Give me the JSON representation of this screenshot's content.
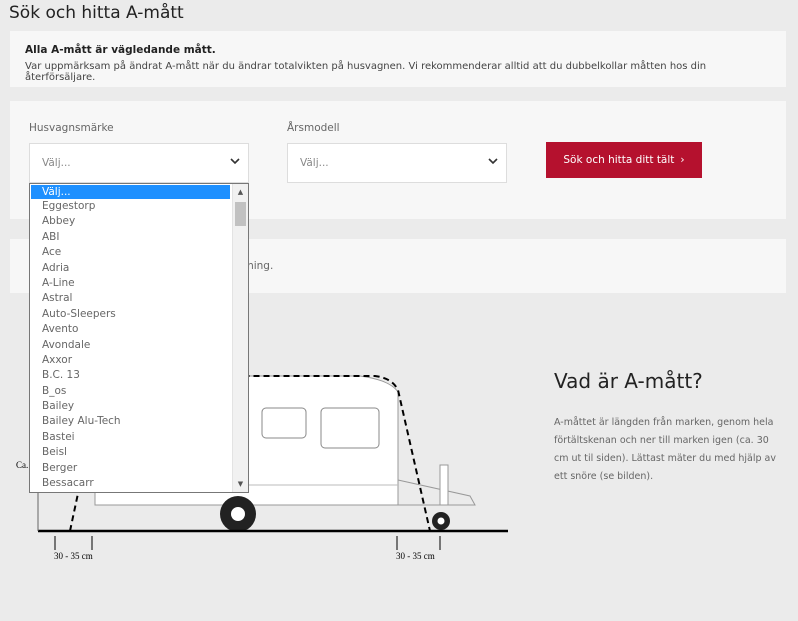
{
  "page": {
    "title": "Sök och hitta A-mått"
  },
  "info": {
    "bold": "Alla A-mått är vägledande mått.",
    "text": "Var uppmärksam på ändrat A-mått när du ändrar totalvikten på husvagnen. Vi rekommenderar alltid att du dubbelkollar måtten hos din återförsäljare."
  },
  "search": {
    "brand_label": "Husvagnsmärke",
    "brand_value": "Välj...",
    "year_label": "Årsmodell",
    "year_value": "Välj...",
    "button_label": "Sök och hitta ditt tält",
    "button_arrow": "›"
  },
  "notice": {
    "tail_text": "kning."
  },
  "dropdown": {
    "options": [
      "Välj...",
      "Eggestorp",
      "Abbey",
      "ABI",
      "Ace",
      "Adria",
      "A-Line",
      "Astral",
      "Auto-Sleepers",
      "Avento",
      "Avondale",
      "Axxor",
      "B.C. 13",
      "B_os",
      "Bailey",
      "Bailey Alu-Tech",
      "Bastei",
      "Beisl",
      "Berger",
      "Bessacarr"
    ],
    "selected_index": 0,
    "scroll_up": "▲",
    "scroll_down": "▼"
  },
  "diagram": {
    "left_measure": "30 - 35 cm",
    "right_measure": "30 - 35 cm",
    "side_label": "Ca."
  },
  "about": {
    "title": "Vad är A-mått?",
    "text": "A-måttet är längden från marken, genom hela förtältskenan och ner till marken igen (ca. 30 cm ut til siden). Lättast mäter du med hjälp av ett snöre (se bilden)."
  },
  "colors": {
    "accent": "#b5112e",
    "selected": "#1e90ff"
  }
}
